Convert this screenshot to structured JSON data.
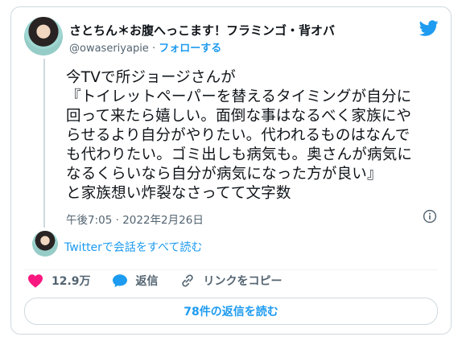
{
  "author": {
    "display_name": "さとちん＊お腹へっこます！フラミンゴ・背オバ",
    "handle": "@owaseriyapie",
    "separator": "·",
    "follow_label": "フォローする"
  },
  "tweet": {
    "text": "今TVで所ジョージさんが\n『トイレットペーパーを替えるタイミングが自分に\n回って来たら嬉しい。面倒な事はなるべく家族にや\nらせるより自分がやりたい。代われるものはなんで\nも代わりたい。ゴミ出しも病気も。奥さんが病気に\nなるくらいなら自分が病気になった方が良い』\nと家族想い炸裂なさってて文字数",
    "timestamp": "午後7:05 · 2022年2月26日"
  },
  "conversation": {
    "read_label": "Twitterで会話をすべて読む"
  },
  "actions": {
    "like_count": "12.9万",
    "reply_label": "返信",
    "copy_link_label": "リンクをコピー"
  },
  "replies_button": {
    "label": "78件の返信を読む"
  },
  "icons": {
    "brand": "twitter-bird-icon",
    "info": "info-icon",
    "like": "heart-icon",
    "reply": "speech-bubble-icon",
    "link": "link-icon"
  },
  "colors": {
    "accent": "#1d9bf0",
    "like": "#f91880",
    "muted": "#536471",
    "border": "#cfd9de"
  }
}
